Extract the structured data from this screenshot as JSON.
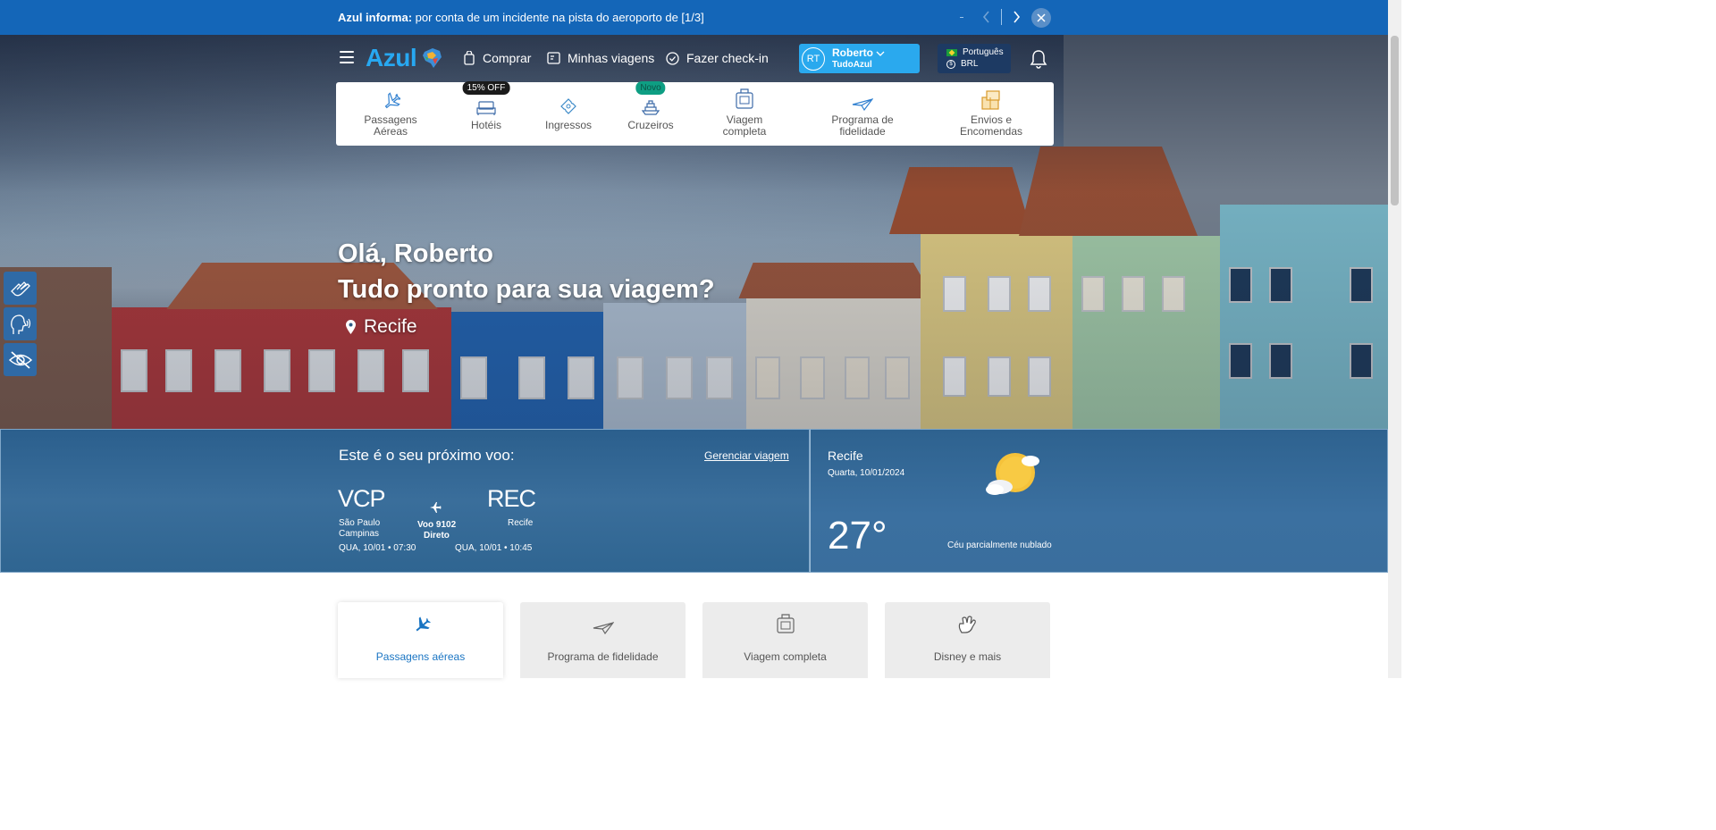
{
  "announcement": {
    "prefix": "Azul informa:",
    "text": " por conta de um incidente na pista do aeroporto de [1/3]"
  },
  "header": {
    "logo": "Azul",
    "links": [
      {
        "label": "Comprar",
        "icon": "cart-icon"
      },
      {
        "label": "Minhas viagens",
        "icon": "trips-icon"
      },
      {
        "label": "Fazer check-in",
        "icon": "checkin-icon"
      }
    ],
    "user": {
      "initials": "RT",
      "name": "Roberto",
      "program": "TudoAzul"
    },
    "language": {
      "label": "Português",
      "currency": "BRL"
    }
  },
  "products": [
    {
      "label": "Passagens Aéreas",
      "icon": "plane-icon",
      "badge": ""
    },
    {
      "label": "Hotéis",
      "icon": "hotel-icon",
      "badge": "15% OFF"
    },
    {
      "label": "Ingressos",
      "icon": "ticket-icon",
      "badge": ""
    },
    {
      "label": "Cruzeiros",
      "icon": "cruise-icon",
      "badge": "Novo"
    },
    {
      "label": "Viagem completa",
      "icon": "luggage-icon",
      "badge": ""
    },
    {
      "label": "Programa de fidelidade",
      "icon": "paper-plane-icon",
      "badge": ""
    },
    {
      "label": "Envios e Encomendas",
      "icon": "package-icon",
      "badge": ""
    }
  ],
  "greeting": {
    "line1": "Olá, Roberto",
    "line2": "Tudo pronto para sua viagem?",
    "location": "Recife"
  },
  "flight": {
    "title": "Este é o seu próximo voo:",
    "manage": "Gerenciar viagem",
    "origin": {
      "code": "VCP",
      "city1": "São Paulo",
      "city2": "Campinas",
      "datetime": "QUA, 10/01 • 07:30"
    },
    "destination": {
      "code": "REC",
      "city1": "Recife",
      "datetime": "QUA, 10/01 • 10:45"
    },
    "flight_no": "Voo 9102",
    "type": "Direto"
  },
  "weather": {
    "city": "Recife",
    "date": "Quarta, 10/01/2024",
    "temperature": "27°",
    "condition": "Céu parcialmente nublado"
  },
  "tabs": [
    {
      "label": "Passagens aéreas",
      "icon": "plane-icon",
      "active": true
    },
    {
      "label": "Programa de fidelidade",
      "icon": "paper-plane-icon",
      "active": false
    },
    {
      "label": "Viagem completa",
      "icon": "luggage-icon",
      "active": false
    },
    {
      "label": "Disney e mais",
      "icon": "glove-icon",
      "active": false
    }
  ],
  "colors": {
    "brand": "#1466b8",
    "accent": "#2aa9ee",
    "tab_active": "#1a75c3"
  }
}
